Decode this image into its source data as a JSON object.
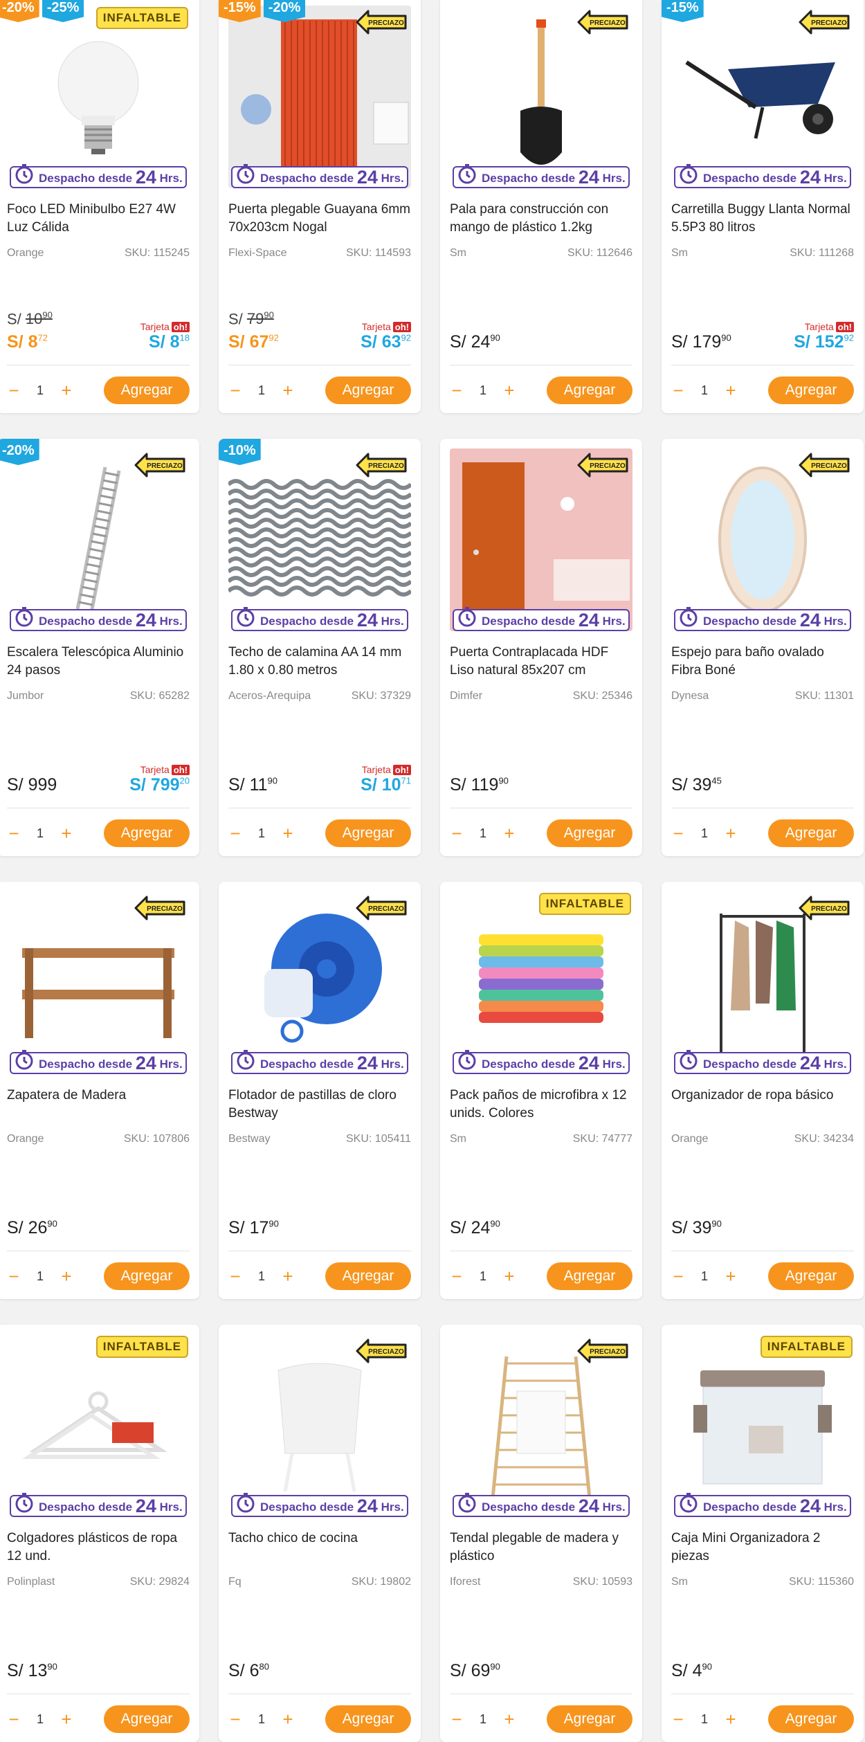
{
  "despacho": {
    "label": "Despacho desde",
    "num": "24",
    "hrs": "Hrs."
  },
  "tags": {
    "inflatable": "INFALTABLE",
    "preciazo": "PRECIAZO"
  },
  "tarjeta_label": "Tarjeta",
  "oh_label": "oh!",
  "currency": "S/",
  "add_label": "Agregar",
  "products": [
    {
      "title": "Foco LED Minibulbo E27 4W Luz Cálida",
      "brand": "Orange",
      "sku": "SKU: 115245",
      "badges": [
        {
          "t": "-20%",
          "c": "orange"
        },
        {
          "t": "-25%",
          "c": "blue"
        }
      ],
      "tag": "inflatable",
      "image": "bulb",
      "old_int": "10",
      "old_dec": "90",
      "disc_int": "8",
      "disc_dec": "72",
      "tarjeta_int": "8",
      "tarjeta_dec": "18",
      "reg_int": "",
      "reg_dec": "",
      "qty": "1"
    },
    {
      "title": "Puerta plegable Guayana 6mm 70x203cm Nogal",
      "brand": "Flexi-Space",
      "sku": "SKU: 114593",
      "badges": [
        {
          "t": "-15%",
          "c": "orange"
        },
        {
          "t": "-20%",
          "c": "blue"
        }
      ],
      "tag": "preciazo",
      "image": "folding-door",
      "old_int": "79",
      "old_dec": "90",
      "disc_int": "67",
      "disc_dec": "92",
      "tarjeta_int": "63",
      "tarjeta_dec": "92",
      "reg_int": "",
      "reg_dec": "",
      "qty": "1"
    },
    {
      "title": "Pala para construcción con mango de plástico 1.2kg",
      "brand": "Sm",
      "sku": "SKU: 112646",
      "badges": [],
      "tag": "preciazo",
      "image": "shovel",
      "old_int": "",
      "old_dec": "",
      "disc_int": "",
      "disc_dec": "",
      "tarjeta_int": "",
      "tarjeta_dec": "",
      "reg_int": "24",
      "reg_dec": "90",
      "qty": "1"
    },
    {
      "title": "Carretilla Buggy Llanta Normal 5.5P3 80 litros",
      "brand": "Sm",
      "sku": "SKU: 111268",
      "badges": [
        {
          "t": "-15%",
          "c": "blue"
        }
      ],
      "tag": "preciazo",
      "image": "wheelbarrow",
      "old_int": "",
      "old_dec": "",
      "disc_int": "",
      "disc_dec": "",
      "tarjeta_int": "152",
      "tarjeta_dec": "92",
      "reg_int": "179",
      "reg_dec": "90",
      "qty": "1"
    },
    {
      "title": "Escalera Telescópica Aluminio 24 pasos",
      "brand": "Jumbor",
      "sku": "SKU: 65282",
      "badges": [
        {
          "t": "-20%",
          "c": "blue"
        }
      ],
      "tag": "preciazo",
      "image": "ladder",
      "old_int": "",
      "old_dec": "",
      "disc_int": "",
      "disc_dec": "",
      "tarjeta_int": "799",
      "tarjeta_dec": "20",
      "reg_int": "999",
      "reg_dec": "",
      "qty": "1"
    },
    {
      "title": "Techo de calamina AA 14 mm 1.80 x 0.80 metros",
      "brand": "Aceros-Arequipa",
      "sku": "SKU: 37329",
      "badges": [
        {
          "t": "-10%",
          "c": "blue"
        }
      ],
      "tag": "preciazo",
      "image": "roof-sheet",
      "old_int": "",
      "old_dec": "",
      "disc_int": "",
      "disc_dec": "",
      "tarjeta_int": "10",
      "tarjeta_dec": "71",
      "reg_int": "11",
      "reg_dec": "90",
      "qty": "1"
    },
    {
      "title": "Puerta Contraplacada HDF Liso natural 85x207 cm",
      "brand": "Dimfer",
      "sku": "SKU: 25346",
      "badges": [],
      "tag": "preciazo",
      "image": "door",
      "old_int": "",
      "old_dec": "",
      "disc_int": "",
      "disc_dec": "",
      "tarjeta_int": "",
      "tarjeta_dec": "",
      "reg_int": "119",
      "reg_dec": "90",
      "qty": "1"
    },
    {
      "title": "Espejo para baño ovalado Fibra Boné",
      "brand": "Dynesa",
      "sku": "SKU: 11301",
      "badges": [],
      "tag": "preciazo",
      "image": "mirror",
      "old_int": "",
      "old_dec": "",
      "disc_int": "",
      "disc_dec": "",
      "tarjeta_int": "",
      "tarjeta_dec": "",
      "reg_int": "39",
      "reg_dec": "45",
      "qty": "1"
    },
    {
      "title": "Zapatera de Madera",
      "brand": "Orange",
      "sku": "SKU: 107806",
      "badges": [],
      "tag": "preciazo",
      "image": "shoe-rack",
      "old_int": "",
      "old_dec": "",
      "disc_int": "",
      "disc_dec": "",
      "tarjeta_int": "",
      "tarjeta_dec": "",
      "reg_int": "26",
      "reg_dec": "90",
      "qty": "1"
    },
    {
      "title": "Flotador de pastillas de cloro Bestway",
      "brand": "Bestway",
      "sku": "SKU: 105411",
      "badges": [],
      "tag": "preciazo",
      "image": "chlorine-float",
      "old_int": "",
      "old_dec": "",
      "disc_int": "",
      "disc_dec": "",
      "tarjeta_int": "",
      "tarjeta_dec": "",
      "reg_int": "17",
      "reg_dec": "90",
      "qty": "1"
    },
    {
      "title": "Pack paños de microfibra x 12 unids. Colores",
      "brand": "Sm",
      "sku": "SKU: 74777",
      "badges": [],
      "tag": "inflatable",
      "image": "microfiber",
      "old_int": "",
      "old_dec": "",
      "disc_int": "",
      "disc_dec": "",
      "tarjeta_int": "",
      "tarjeta_dec": "",
      "reg_int": "24",
      "reg_dec": "90",
      "qty": "1"
    },
    {
      "title": "Organizador de ropa básico",
      "brand": "Orange",
      "sku": "SKU: 34234",
      "badges": [],
      "tag": "preciazo",
      "image": "clothes-rack",
      "old_int": "",
      "old_dec": "",
      "disc_int": "",
      "disc_dec": "",
      "tarjeta_int": "",
      "tarjeta_dec": "",
      "reg_int": "39",
      "reg_dec": "90",
      "qty": "1"
    },
    {
      "title": "Colgadores plásticos de ropa 12 und.",
      "brand": "Polinplast",
      "sku": "SKU: 29824",
      "badges": [],
      "tag": "inflatable",
      "image": "hangers",
      "old_int": "",
      "old_dec": "",
      "disc_int": "",
      "disc_dec": "",
      "tarjeta_int": "",
      "tarjeta_dec": "",
      "reg_int": "13",
      "reg_dec": "90",
      "qty": "1"
    },
    {
      "title": "Tacho chico de cocina",
      "brand": "Fq",
      "sku": "SKU: 19802",
      "badges": [],
      "tag": "preciazo",
      "image": "trash-bin",
      "old_int": "",
      "old_dec": "",
      "disc_int": "",
      "disc_dec": "",
      "tarjeta_int": "",
      "tarjeta_dec": "",
      "reg_int": "6",
      "reg_dec": "80",
      "qty": "1"
    },
    {
      "title": "Tendal plegable de madera y plástico",
      "brand": "Iforest",
      "sku": "SKU: 10593",
      "badges": [],
      "tag": "preciazo",
      "image": "drying-rack",
      "old_int": "",
      "old_dec": "",
      "disc_int": "",
      "disc_dec": "",
      "tarjeta_int": "",
      "tarjeta_dec": "",
      "reg_int": "69",
      "reg_dec": "90",
      "qty": "1"
    },
    {
      "title": "Caja Mini Organizadora 2 piezas",
      "brand": "Sm",
      "sku": "SKU: 115360",
      "badges": [],
      "tag": "inflatable",
      "image": "storage-box",
      "old_int": "",
      "old_dec": "",
      "disc_int": "",
      "disc_dec": "",
      "tarjeta_int": "",
      "tarjeta_dec": "",
      "reg_int": "4",
      "reg_dec": "90",
      "qty": "1"
    }
  ]
}
